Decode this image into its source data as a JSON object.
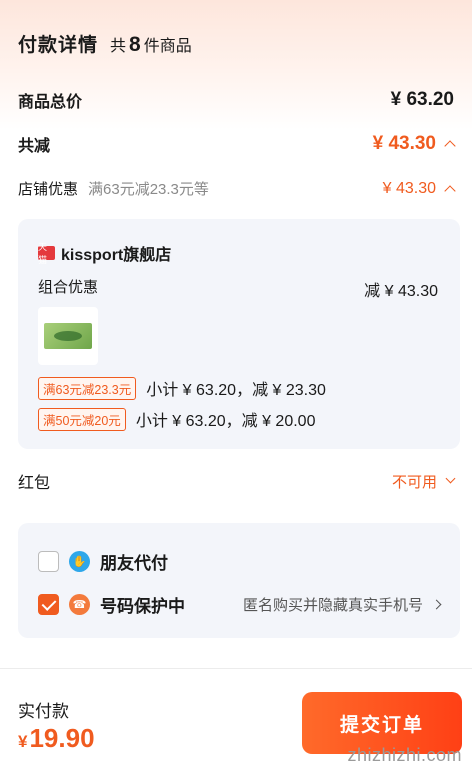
{
  "header": {
    "title": "付款详情",
    "count_prefix": "共",
    "count_num": "8",
    "count_suffix": "件商品"
  },
  "summary": {
    "total_label": "商品总价",
    "total_amount": "¥ 63.20",
    "reduce_label": "共减",
    "reduce_amount": "¥ 43.30"
  },
  "store_discount": {
    "label": "店铺优惠",
    "sub": "满63元减23.3元等",
    "amount": "¥ 43.30"
  },
  "shop": {
    "badge": "天猫",
    "name": "kissport旗舰店",
    "combo_label": "组合优惠",
    "combo_amount": "减 ¥ 43.30",
    "promos": [
      {
        "tag": "满63元减23.3元",
        "text": "小计 ¥ 63.20，减 ¥ 23.30"
      },
      {
        "tag": "满50元减20元",
        "text": "小计 ¥ 63.20，减 ¥ 20.00"
      }
    ]
  },
  "redbag": {
    "label": "红包",
    "value": "不可用"
  },
  "options": {
    "friend_pay": {
      "label": "朋友代付",
      "checked": false
    },
    "number_protect": {
      "label": "号码保护中",
      "checked": true,
      "hint": "匿名购买并隐藏真实手机号"
    }
  },
  "footer": {
    "pay_label": "实付款",
    "pay_amount": "19.90",
    "currency": "¥",
    "submit_label": "提交订单"
  },
  "watermark": "zhizhizhi.com",
  "colors": {
    "accent": "#f05b1f",
    "card_bg": "#f3f5fa"
  }
}
